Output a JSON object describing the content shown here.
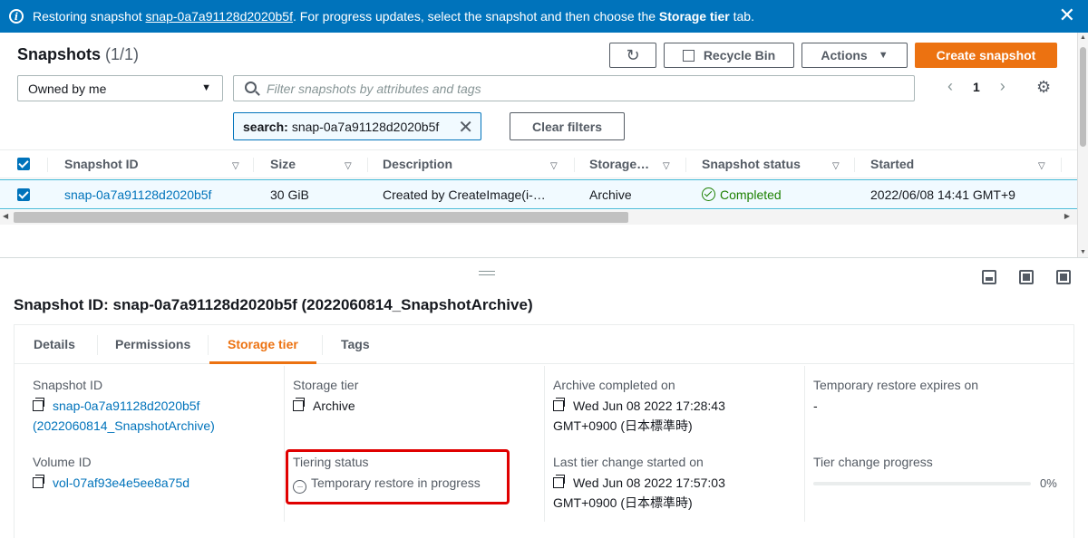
{
  "banner": {
    "prefix": "Restoring snapshot ",
    "snapshot_link": "snap-0a7a91128d2020b5f",
    "middle": ". For progress updates, select the snapshot and then choose the ",
    "tab_name": "Storage tier",
    "suffix": " tab.",
    "close_glyph": "✕"
  },
  "header": {
    "title": "Snapshots",
    "count": "(1/1)",
    "refresh_glyph": "↻",
    "recycle_label": "Recycle Bin",
    "actions_label": "Actions",
    "create_label": "Create snapshot"
  },
  "filters": {
    "owner_select": "Owned by me",
    "search_placeholder": "Filter snapshots by attributes and tags",
    "token_key": "search:",
    "token_value": "snap-0a7a91128d2020b5f",
    "clear_label": "Clear filters",
    "page_current": "1"
  },
  "table": {
    "columns": [
      "Snapshot ID",
      "Size",
      "Description",
      "Storage…",
      "Snapshot status",
      "Started"
    ],
    "rows": [
      {
        "id": "snap-0a7a91128d2020b5f",
        "size": "30 GiB",
        "description": "Created by CreateImage(i-…",
        "storage": "Archive",
        "status": "Completed",
        "started": "2022/06/08 14:41 GMT+9"
      }
    ]
  },
  "detail": {
    "title": "Snapshot ID: snap-0a7a91128d2020b5f (2022060814_SnapshotArchive)",
    "tabs": [
      "Details",
      "Permissions",
      "Storage tier",
      "Tags"
    ],
    "active_tab": "Storage tier",
    "fields": {
      "snapshot_id_label": "Snapshot ID",
      "snapshot_id_line1": "snap-0a7a91128d2020b5f",
      "snapshot_id_line2": "(2022060814_SnapshotArchive)",
      "volume_id_label": "Volume ID",
      "volume_id": "vol-07af93e4e5ee8a75d",
      "storage_tier_label": "Storage tier",
      "storage_tier": "Archive",
      "tiering_status_label": "Tiering status",
      "tiering_status": "Temporary restore in progress",
      "archive_completed_label": "Archive completed on",
      "archive_completed_line1": "Wed Jun 08 2022 17:28:43",
      "archive_completed_line2": "GMT+0900 (日本標準時)",
      "last_tier_change_label": "Last tier change started on",
      "last_tier_change_line1": "Wed Jun 08 2022 17:57:03",
      "last_tier_change_line2": "GMT+0900 (日本標準時)",
      "restore_expires_label": "Temporary restore expires on",
      "restore_expires": "-",
      "tier_change_progress_label": "Tier change progress",
      "tier_change_progress_text": "0%",
      "tier_change_progress_value": 0
    }
  },
  "colors": {
    "banner": "#0073bb",
    "primary": "#ec7211",
    "link": "#0073bb",
    "success": "#1d8102",
    "highlight_box": "#e00000"
  }
}
